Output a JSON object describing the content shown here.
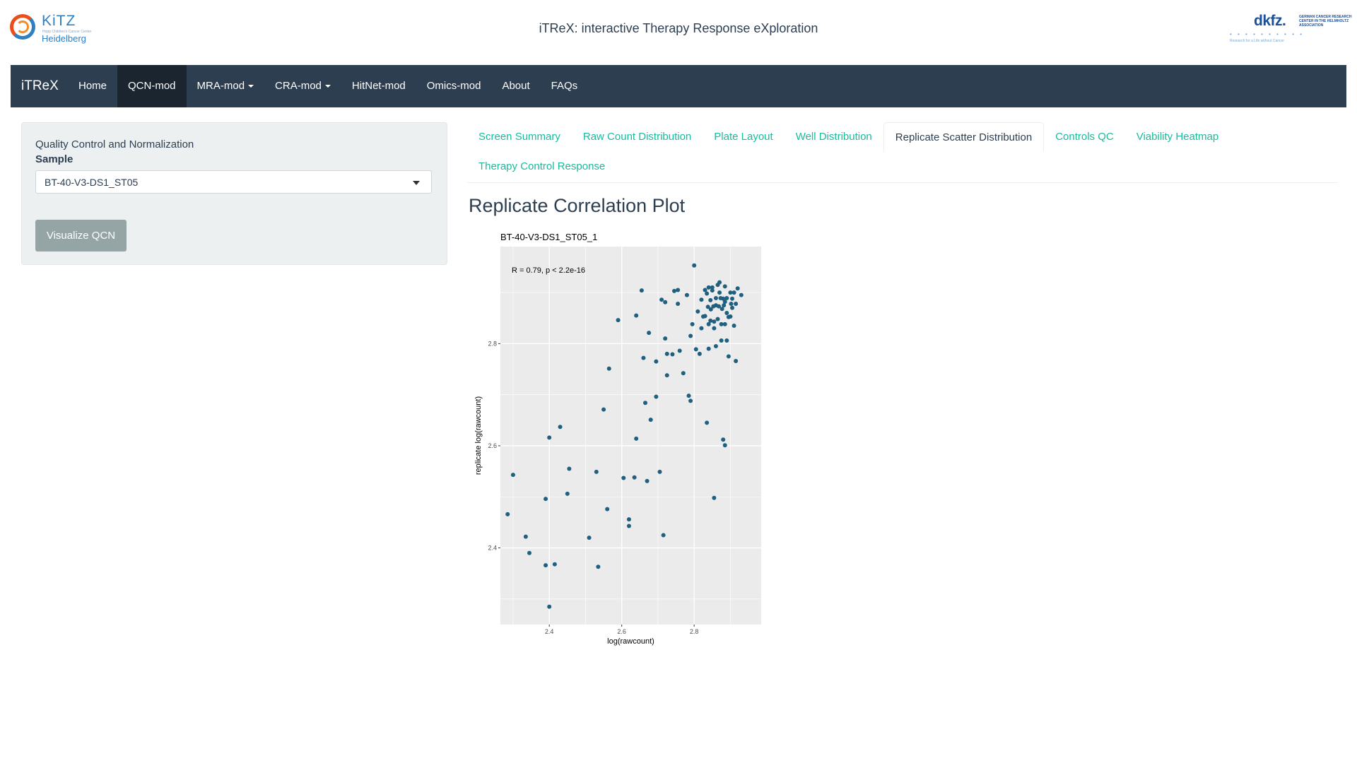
{
  "header": {
    "logo_left": {
      "name": "KiTZ",
      "tagline": "Hopp Children's Cancer Center",
      "city": "Heidelberg"
    },
    "title": "iTReX: interactive Therapy Response eXploration",
    "logo_right": {
      "name": "dkfz.",
      "subtitle": "GERMAN CANCER RESEARCH CENTER IN THE HELMHOLTZ ASSOCIATION",
      "tagline": "Research for a Life without Cancer"
    }
  },
  "navbar": {
    "brand": "iTReX",
    "items": [
      {
        "label": "Home",
        "active": false,
        "dropdown": false
      },
      {
        "label": "QCN-mod",
        "active": true,
        "dropdown": false
      },
      {
        "label": "MRA-mod",
        "active": false,
        "dropdown": true
      },
      {
        "label": "CRA-mod",
        "active": false,
        "dropdown": true
      },
      {
        "label": "HitNet-mod",
        "active": false,
        "dropdown": false
      },
      {
        "label": "Omics-mod",
        "active": false,
        "dropdown": false
      },
      {
        "label": "About",
        "active": false,
        "dropdown": false
      },
      {
        "label": "FAQs",
        "active": false,
        "dropdown": false
      }
    ]
  },
  "sidebar": {
    "heading": "Quality Control and Normalization",
    "sample_label": "Sample",
    "sample_value": "BT-40-V3-DS1_ST05",
    "button_label": "Visualize QCN"
  },
  "tabs": {
    "row1": [
      "Screen Summary",
      "Raw Count Distribution",
      "Plate Layout",
      "Well Distribution",
      "Replicate Scatter Distribution",
      "Controls QC",
      "Viability Heatmap"
    ],
    "row2": [
      "Therapy Control Response"
    ],
    "active": "Replicate Scatter Distribution"
  },
  "main": {
    "section_title": "Replicate Correlation Plot"
  },
  "colors": {
    "navbar": "#2c3e50",
    "navbar_active": "#1a252f",
    "tab_link": "#18bc9c",
    "button": "#95a5a6",
    "sidebar_bg": "#ecf0f1",
    "plot_panel": "#ebebeb",
    "point": "#1f5f7f"
  },
  "chart_data": {
    "type": "scatter",
    "title": "BT-40-V3-DS1_ST05_1",
    "annotation": "R = 0.79, p < 2.2e-16",
    "xlabel": "log(rawcount)",
    "ylabel": "replicate log(rawcount)",
    "xlim": [
      2.265,
      2.985
    ],
    "ylim": [
      2.25,
      2.99
    ],
    "xticks": [
      2.4,
      2.6,
      2.8
    ],
    "yticks": [
      2.4,
      2.6,
      2.8
    ],
    "grid": true,
    "points": [
      [
        2.285,
        2.466
      ],
      [
        2.3,
        2.543
      ],
      [
        2.335,
        2.422
      ],
      [
        2.345,
        2.39
      ],
      [
        2.39,
        2.366
      ],
      [
        2.39,
        2.496
      ],
      [
        2.4,
        2.285
      ],
      [
        2.4,
        2.616
      ],
      [
        2.415,
        2.368
      ],
      [
        2.43,
        2.637
      ],
      [
        2.45,
        2.506
      ],
      [
        2.455,
        2.555
      ],
      [
        2.51,
        2.42
      ],
      [
        2.53,
        2.549
      ],
      [
        2.535,
        2.363
      ],
      [
        2.55,
        2.671
      ],
      [
        2.56,
        2.476
      ],
      [
        2.565,
        2.751
      ],
      [
        2.59,
        2.846
      ],
      [
        2.605,
        2.537
      ],
      [
        2.62,
        2.456
      ],
      [
        2.62,
        2.443
      ],
      [
        2.635,
        2.538
      ],
      [
        2.64,
        2.614
      ],
      [
        2.64,
        2.855
      ],
      [
        2.655,
        2.904
      ],
      [
        2.66,
        2.772
      ],
      [
        2.665,
        2.684
      ],
      [
        2.67,
        2.531
      ],
      [
        2.675,
        2.821
      ],
      [
        2.68,
        2.651
      ],
      [
        2.695,
        2.765
      ],
      [
        2.695,
        2.696
      ],
      [
        2.705,
        2.549
      ],
      [
        2.71,
        2.886
      ],
      [
        2.715,
        2.425
      ],
      [
        2.72,
        2.81
      ],
      [
        2.72,
        2.881
      ],
      [
        2.725,
        2.738
      ],
      [
        2.725,
        2.78
      ],
      [
        2.74,
        2.779
      ],
      [
        2.745,
        2.903
      ],
      [
        2.755,
        2.878
      ],
      [
        2.755,
        2.905
      ],
      [
        2.76,
        2.786
      ],
      [
        2.77,
        2.742
      ],
      [
        2.78,
        2.895
      ],
      [
        2.785,
        2.698
      ],
      [
        2.79,
        2.688
      ],
      [
        2.79,
        2.815
      ],
      [
        2.795,
        2.838
      ],
      [
        2.8,
        2.953
      ],
      [
        2.805,
        2.789
      ],
      [
        2.81,
        2.863
      ],
      [
        2.815,
        2.78
      ],
      [
        2.82,
        2.886
      ],
      [
        2.82,
        2.83
      ],
      [
        2.825,
        2.853
      ],
      [
        2.83,
        2.854
      ],
      [
        2.83,
        2.905
      ],
      [
        2.835,
        2.645
      ],
      [
        2.835,
        2.898
      ],
      [
        2.84,
        2.79
      ],
      [
        2.84,
        2.838
      ],
      [
        2.84,
        2.91
      ],
      [
        2.845,
        2.885
      ],
      [
        2.845,
        2.845
      ],
      [
        2.85,
        2.904
      ],
      [
        2.85,
        2.91
      ],
      [
        2.855,
        2.498
      ],
      [
        2.855,
        2.83
      ],
      [
        2.855,
        2.843
      ],
      [
        2.86,
        2.795
      ],
      [
        2.86,
        2.875
      ],
      [
        2.865,
        2.915
      ],
      [
        2.865,
        2.848
      ],
      [
        2.87,
        2.92
      ],
      [
        2.87,
        2.9
      ],
      [
        2.875,
        2.838
      ],
      [
        2.875,
        2.806
      ],
      [
        2.88,
        2.612
      ],
      [
        2.88,
        2.888
      ],
      [
        2.885,
        2.601
      ],
      [
        2.885,
        2.838
      ],
      [
        2.885,
        2.912
      ],
      [
        2.885,
        2.882
      ],
      [
        2.89,
        2.86
      ],
      [
        2.89,
        2.806
      ],
      [
        2.89,
        2.889
      ],
      [
        2.895,
        2.852
      ],
      [
        2.895,
        2.775
      ],
      [
        2.9,
        2.9
      ],
      [
        2.9,
        2.853
      ],
      [
        2.905,
        2.888
      ],
      [
        2.905,
        2.87
      ],
      [
        2.91,
        2.835
      ],
      [
        2.91,
        2.9
      ],
      [
        2.915,
        2.766
      ],
      [
        2.915,
        2.878
      ],
      [
        2.92,
        2.908
      ],
      [
        2.93,
        2.895
      ],
      [
        2.86,
        2.889
      ],
      [
        2.868,
        2.873
      ],
      [
        2.877,
        2.868
      ],
      [
        2.853,
        2.873
      ],
      [
        2.846,
        2.867
      ],
      [
        2.882,
        2.875
      ],
      [
        2.838,
        2.872
      ],
      [
        2.902,
        2.878
      ],
      [
        2.873,
        2.889
      ]
    ]
  }
}
